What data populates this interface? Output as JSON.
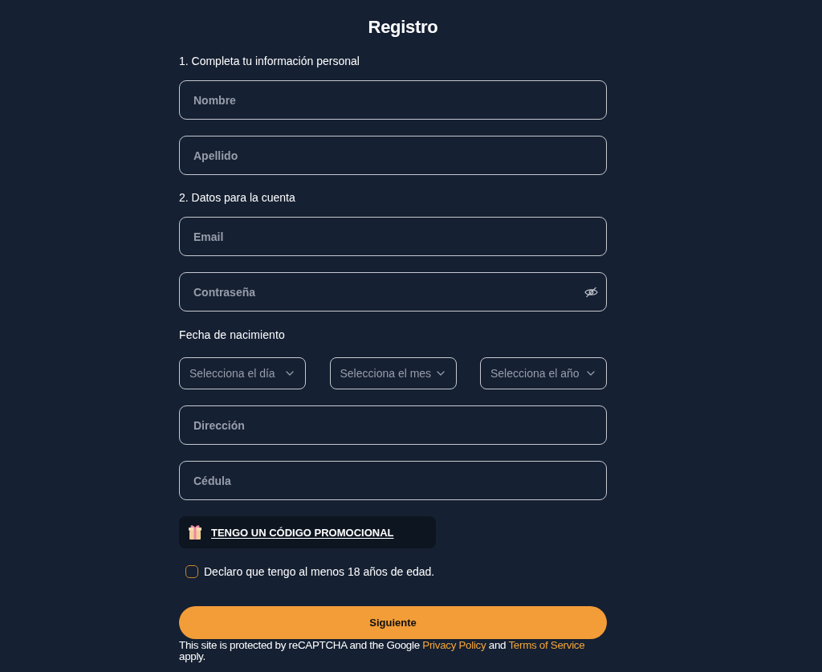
{
  "page": {
    "title": "Registro"
  },
  "form": {
    "items": [
      {
        "kind": "section_label",
        "text": "1. Completa tu información personal"
      },
      {
        "kind": "text_field",
        "placeholder": "Nombre"
      },
      {
        "kind": "text_field",
        "placeholder": "Apellido"
      },
      {
        "kind": "section_label",
        "text": "2. Datos para la cuenta"
      },
      {
        "kind": "text_field",
        "placeholder": "Email"
      },
      {
        "kind": "password_field",
        "placeholder": "Contraseña"
      },
      {
        "kind": "label",
        "text": "Fecha de nacimiento"
      },
      {
        "kind": "select_row",
        "selects": [
          {
            "placeholder": "Selecciona el día"
          },
          {
            "placeholder": "Selecciona el mes"
          },
          {
            "placeholder": "Selecciona el año"
          }
        ]
      },
      {
        "kind": "text_field",
        "placeholder": "Dirección"
      },
      {
        "kind": "text_field",
        "placeholder": "Cédula"
      }
    ]
  },
  "promo_code": {
    "label": "TENGO UN CÓDIGO PROMOCIONAL"
  },
  "age_checkbox": {
    "label": "Declaro que tengo al menos 18 años de edad.",
    "checked": false
  },
  "submit_button": {
    "label": "Siguiente"
  },
  "recaptcha_notice": {
    "parts": [
      {
        "kind": "text",
        "text": "This site is protected by reCAPTCHA and the Google"
      },
      {
        "kind": "link",
        "text": "Privacy Policy"
      },
      {
        "kind": "text",
        "text": "and"
      },
      {
        "kind": "link",
        "text": "Terms of Service"
      },
      {
        "kind": "text",
        "text": "apply."
      }
    ]
  }
}
